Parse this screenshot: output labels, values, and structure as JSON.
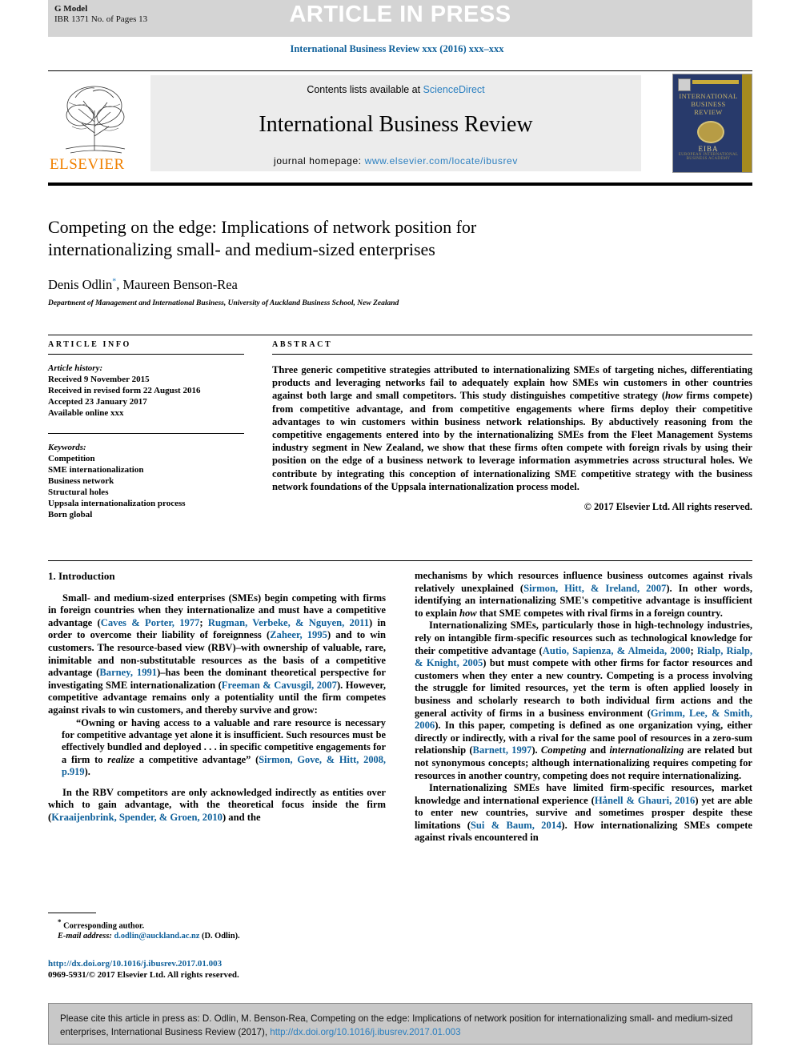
{
  "banner": {
    "g_model": "G Model",
    "ibr_line": "IBR 1371 No. of Pages 13",
    "article_in_press": "ARTICLE IN PRESS"
  },
  "journal_ref": "International Business Review xxx (2016) xxx–xxx",
  "masthead": {
    "publisher": "ELSEVIER",
    "contents_prefix": "Contents lists available at ",
    "contents_link": "ScienceDirect",
    "journal_name": "International Business Review",
    "homepage_prefix": "journal homepage: ",
    "homepage_url": "www.elsevier.com/locate/ibusrev",
    "cover_title": "INTERNATIONAL BUSINESS REVIEW",
    "cover_society": "EIBA",
    "cover_society_sub": "EUROPEAN INTERNATIONAL BUSINESS ACADEMY"
  },
  "article": {
    "title": "Competing on the edge: Implications of network position for internationalizing small- and medium-sized enterprises",
    "authors": "Denis Odlin, Maureen Benson-Rea",
    "author_marker": "*",
    "affiliation": "Department of Management and International Business, University of Auckland Business School, New Zealand"
  },
  "article_info": {
    "heading": "ARTICLE INFO",
    "history_label": "Article history:",
    "history": [
      "Received 9 November 2015",
      "Received in revised form 22 August 2016",
      "Accepted 23 January 2017",
      "Available online xxx"
    ],
    "keywords_label": "Keywords:",
    "keywords": [
      "Competition",
      "SME internationalization",
      "Business network",
      "Structural holes",
      "Uppsala internationalization process",
      "Born global"
    ]
  },
  "abstract": {
    "heading": "ABSTRACT",
    "text_1": "Three generic competitive strategies attributed to internationalizing SMEs of targeting niches, differentiating products and leveraging networks fail to adequately explain how SMEs win customers in other countries against both large and small competitors. This study distinguishes competitive strategy (",
    "text_how": "how",
    "text_2": " firms compete) from competitive advantage, and from competitive engagements where firms deploy their competitive advantages to win customers within business network relationships. By abductively reasoning from the competitive engagements entered into by the internationalizing SMEs from the Fleet Management Systems industry segment in New Zealand, we show that these firms often compete with foreign rivals by using their position on the edge of a business network to leverage information asymmetries across structural holes. We contribute by integrating this conception of internationalizing SME competitive strategy with the business network foundations of the Uppsala internationalization process model.",
    "copyright": "© 2017 Elsevier Ltd. All rights reserved."
  },
  "body": {
    "section_title": "1. Introduction",
    "left": {
      "p1_a": "Small- and medium-sized enterprises (SMEs) begin competing with firms in foreign countries when they internationalize and must have a competitive advantage (",
      "p1_ref1": "Caves & Porter, 1977",
      "p1_b": "; ",
      "p1_ref2": "Rugman, Verbeke, & Nguyen, 2011",
      "p1_c": ") in order to overcome their liability of foreignness (",
      "p1_ref3": "Zaheer, 1995",
      "p1_d": ") and to win customers. The resource-based view (RBV)–with ownership of valuable, rare, inimitable and non-substitutable resources as the basis of a competitive advantage (",
      "p1_ref4": "Barney, 1991",
      "p1_e": ")–has been the dominant theoretical perspective for investigating SME internationalization (",
      "p1_ref5": "Freeman & Cavusgil, 2007",
      "p1_f": "). However, competitive advantage remains only a potentiality until the firm competes against rivals to win customers, and thereby survive and grow:",
      "quote_a": "“Owning or having access to a valuable and rare resource is necessary for competitive advantage yet alone it is insufficient. Such resources must be effectively bundled and deployed . . . in specific competitive engagements for a firm to ",
      "quote_realize": "realize",
      "quote_b": " a competitive advantage” (",
      "quote_ref": "Sirmon, Gove, & Hitt, 2008, p.919",
      "quote_c": ").",
      "p2_a": "In the RBV competitors are only acknowledged indirectly as entities over which to gain advantage, with the theoretical focus inside the firm (",
      "p2_ref": "Kraaijenbrink, Spender, & Groen, 2010",
      "p2_b": ") and the"
    },
    "right": {
      "p1_a": "mechanisms by which resources influence business outcomes against rivals relatively unexplained (",
      "p1_ref": "Sirmon, Hitt, & Ireland, 2007",
      "p1_b": "). In other words, identifying an internationalizing SME's competitive advantage is insufficient to explain ",
      "p1_how": "how",
      "p1_c": " that SME competes with rival firms in a foreign country.",
      "p2_a": "Internationalizing SMEs, particularly those in high-technology industries, rely on intangible firm-specific resources such as technological knowledge for their competitive advantage (",
      "p2_ref1": "Autio, Sapienza, & Almeida, 2000",
      "p2_b": "; ",
      "p2_ref2": "Rialp, Rialp, & Knight, 2005",
      "p2_c": ") but must compete with other firms for factor resources and customers when they enter a new country. Competing is a process involving the struggle for limited resources, yet the term is often applied loosely in business and scholarly research to both individual firm actions and the general activity of firms in a business environment (",
      "p2_ref3": "Grimm, Lee, & Smith, 2006",
      "p2_d": "). In this paper, competing is defined as one organization vying, either directly or indirectly, with a rival for the same pool of resources in a zero-sum relationship (",
      "p2_ref4": "Barnett, 1997",
      "p2_e": "). ",
      "p2_it1": "Competing",
      "p2_f": " and ",
      "p2_it2": "internationalizing",
      "p2_g": " are related but not synonymous concepts; although internationalizing requires competing for resources in another country, competing does not require internationalizing.",
      "p3_a": "Internationalizing SMEs have limited firm-specific resources, market knowledge and international experience (",
      "p3_ref1": "Hånell & Ghauri, 2016",
      "p3_b": ") yet are able to enter new countries, survive and sometimes prosper despite these limitations (",
      "p3_ref2": "Sui & Baum, 2014",
      "p3_c": "). How internationalizing SMEs compete against rivals encountered in"
    }
  },
  "footnote": {
    "corresponding": "Corresponding author.",
    "email_label": "E-mail address:",
    "email": "d.odlin@auckland.ac.nz",
    "email_suffix": " (D. Odlin)."
  },
  "footer": {
    "doi": "http://dx.doi.org/10.1016/j.ibusrev.2017.01.003",
    "issn_line": "0969-5931/© 2017 Elsevier Ltd. All rights reserved."
  },
  "citation_box": {
    "text_a": "Please cite this article in press as: D. Odlin, M. Benson-Rea, Competing on the edge: Implications of network position for internationalizing small- and medium-sized enterprises, International Business Review (2017), ",
    "link": "http://dx.doi.org/10.1016/j.ibusrev.2017.01.003"
  },
  "colors": {
    "link": "#10619b",
    "banner_bg": "#d4d4d4",
    "cover_bg": "#283a6b",
    "elsevier_orange": "#f08000"
  }
}
